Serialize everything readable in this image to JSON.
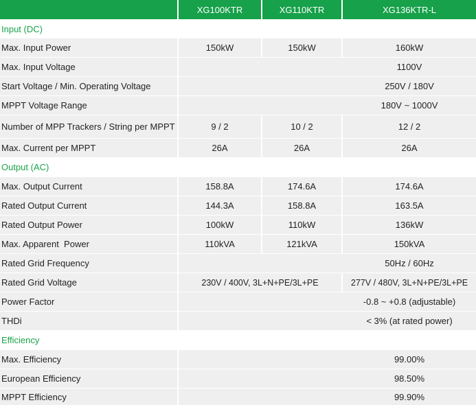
{
  "columns": [
    "XG100KTR",
    "XG110KTR",
    "XG136KTR-L"
  ],
  "sections": {
    "input": "Input (DC)",
    "output": "Output (AC)",
    "efficiency": "Efficiency"
  },
  "rows": {
    "max_input_power": {
      "label": "Max. Input Power",
      "v1": "150kW",
      "v2": "150kW",
      "v3": "160kW"
    },
    "max_input_voltage": {
      "label": "Max. Input Voltage",
      "v": "1100V"
    },
    "start_voltage": {
      "label": "Start Voltage / Min. Operating Voltage",
      "v": "250V / 180V"
    },
    "mppt_range": {
      "label": "MPPT Voltage Range",
      "v": "180V ~ 1000V"
    },
    "mpp_trackers": {
      "label": "Number of MPP Trackers / String per MPPT",
      "v1": "9 / 2",
      "v2": "10 / 2",
      "v3": "12 / 2"
    },
    "max_current_mppt": {
      "label": "Max. Current per MPPT",
      "v1": "26A",
      "v2": "26A",
      "v3": "26A"
    },
    "max_output_current": {
      "label": "Max. Output Current",
      "v1": "158.8A",
      "v2": "174.6A",
      "v3": "174.6A"
    },
    "rated_output_current": {
      "label": "Rated Output Current",
      "v1": "144.3A",
      "v2": "158.8A",
      "v3": "163.5A"
    },
    "rated_output_power": {
      "label": "Rated Output Power",
      "v1": "100kW",
      "v2": "110kW",
      "v3": "136kW"
    },
    "max_apparent_power": {
      "label": "Max. Apparent  Power",
      "v1": "110kVA",
      "v2": "121kVA",
      "v3": "150kVA"
    },
    "rated_grid_frequency": {
      "label": "Rated Grid Frequency",
      "v": "50Hz / 60Hz"
    },
    "rated_grid_voltage": {
      "label": "Rated Grid Voltage",
      "v12": "230V / 400V, 3L+N+PE/3L+PE",
      "v3": "277V / 480V, 3L+N+PE/3L+PE"
    },
    "power_factor": {
      "label": "Power Factor",
      "v": "-0.8 ~ +0.8 (adjustable)"
    },
    "thdi": {
      "label": "THDi",
      "v": "< 3% (at rated power)"
    },
    "max_efficiency": {
      "label": "Max. Efficiency",
      "v": "99.00%"
    },
    "european_efficiency": {
      "label": "European Efficiency",
      "v": "98.50%"
    },
    "mppt_efficiency": {
      "label": "MPPT Efficiency",
      "v": "99.90%"
    }
  },
  "colors": {
    "header_green": "#16a14a",
    "section_green": "#1aa34a",
    "row_gray": "#efefef"
  }
}
